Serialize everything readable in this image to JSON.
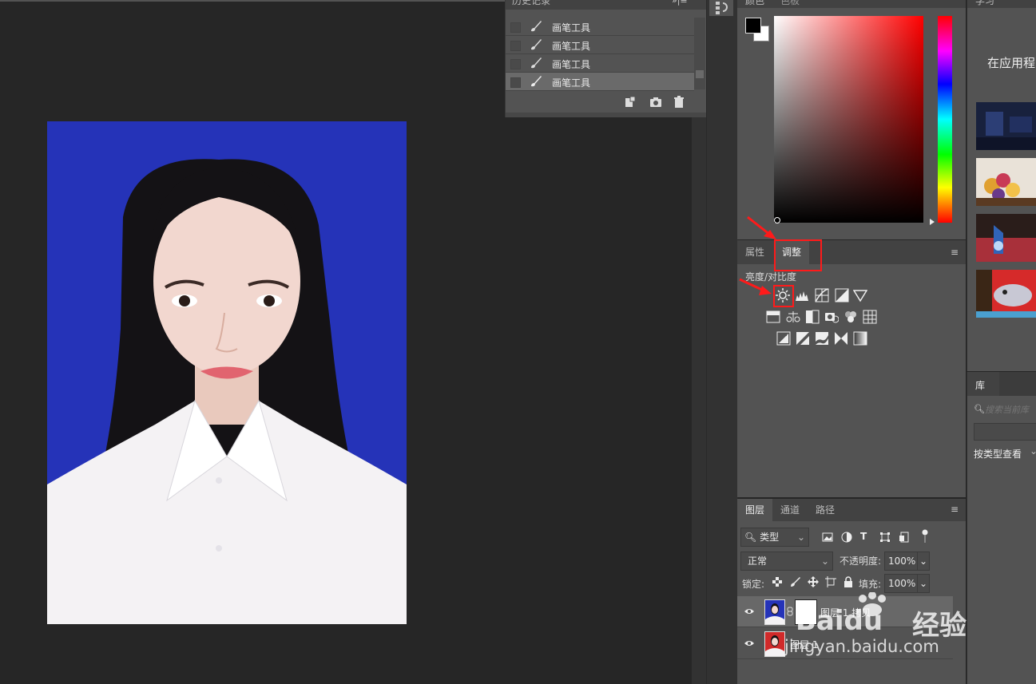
{
  "history": {
    "title": "历史记录",
    "menu_glyph": "»|≡",
    "items": [
      "画笔工具",
      "画笔工具",
      "画笔工具",
      "画笔工具"
    ]
  },
  "color": {
    "tabs": [
      "颜色",
      "色板"
    ],
    "foreground": "#000000",
    "background": "#ffffff"
  },
  "adjustments": {
    "tabs": [
      "属性",
      "调整"
    ],
    "hover_label": "亮度/对比度",
    "menu_glyph": "≡"
  },
  "layers": {
    "tabs": [
      "图层",
      "通道",
      "路径"
    ],
    "filter_label": "类型",
    "blend_mode": "正常",
    "opacity_label": "不透明度:",
    "opacity_value": "100%",
    "lock_label": "锁定:",
    "fill_label": "填充:",
    "fill_value": "100%",
    "rows": [
      {
        "name": "图层 1 拷贝"
      },
      {
        "name": "图层 1"
      }
    ]
  },
  "learn": {
    "tab": "学习",
    "heading": "在应用程"
  },
  "library": {
    "tab": "库",
    "search_placeholder": "搜索当前库",
    "view_label": "按类型查看"
  },
  "watermark": {
    "brand": "Baidu",
    "cn": "经验",
    "url": "jingyan.baidu.com"
  },
  "colors": {
    "photo_bg": "#2533b8",
    "highlight": "#ff1a1a",
    "panel": "#535353"
  }
}
